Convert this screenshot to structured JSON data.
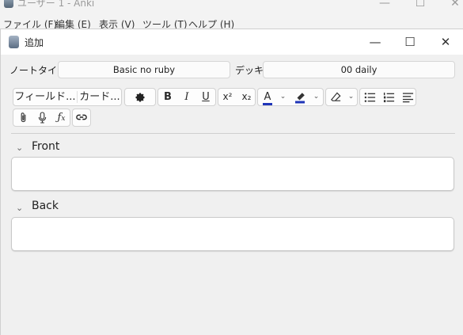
{
  "main_window": {
    "title": "ユーザー 1 - Anki",
    "controls": {
      "minimize": "—",
      "maximize": "☐",
      "close": "✕"
    },
    "menu": [
      "ファイル (F)",
      "編集 (E)",
      "表示 (V)",
      "ツール (T)",
      "ヘルプ (H)"
    ]
  },
  "dialog": {
    "title": "追加",
    "controls": {
      "minimize": "—",
      "maximize": "☐",
      "close": "✕"
    },
    "notetype_label": "ノートタイプ",
    "notetype_value": "Basic no ruby",
    "deck_label": "デッキ",
    "deck_value": "00 daily"
  },
  "toolbar": {
    "fields_button": "フィールド...",
    "cards_button": "カード...",
    "bold": "B",
    "italic": "I",
    "underline": "U",
    "superscript": "x²",
    "subscript": "x₂",
    "text_color": "A",
    "highlight_color_hex": "#1f35b8",
    "text_color_hex": "#1f35b8"
  },
  "fields": [
    {
      "label": "Front",
      "value": ""
    },
    {
      "label": "Back",
      "value": ""
    }
  ]
}
